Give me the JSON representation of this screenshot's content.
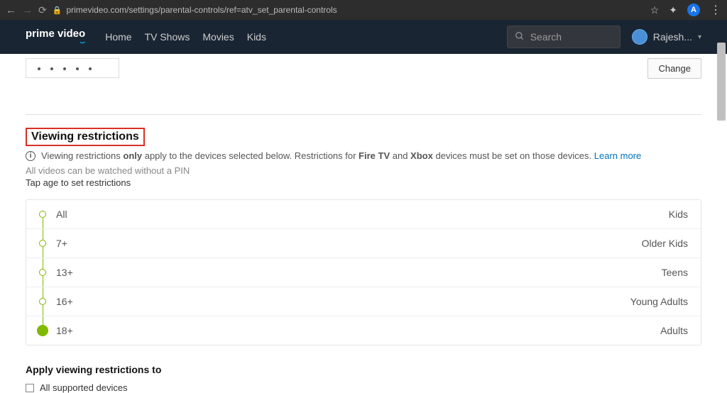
{
  "browser": {
    "url": "primevideo.com/settings/parental-controls/ref=atv_set_parental-controls",
    "avatar_letter": "A"
  },
  "header": {
    "logo": "prime video",
    "nav": [
      "Home",
      "TV Shows",
      "Movies",
      "Kids"
    ],
    "search_placeholder": "Search",
    "user_name": "Rajesh..."
  },
  "pin": {
    "change_label": "Change"
  },
  "viewing": {
    "title": "Viewing restrictions",
    "notice_prefix": "Viewing restrictions ",
    "notice_only": "only",
    "notice_mid": " apply to the devices selected below. Restrictions for ",
    "notice_firetv": "Fire TV",
    "notice_and": " and ",
    "notice_xbox": "Xbox",
    "notice_suffix": " devices must be set on those devices. ",
    "learn_more": "Learn more",
    "sub": "All videos can be watched without a PIN",
    "tap": "Tap age to set restrictions",
    "rows": [
      {
        "label": "All",
        "cat": "Kids"
      },
      {
        "label": "7+",
        "cat": "Older Kids"
      },
      {
        "label": "13+",
        "cat": "Teens"
      },
      {
        "label": "16+",
        "cat": "Young Adults"
      },
      {
        "label": "18+",
        "cat": "Adults"
      }
    ]
  },
  "apply": {
    "title": "Apply viewing restrictions to",
    "devices_label": "All supported devices"
  }
}
